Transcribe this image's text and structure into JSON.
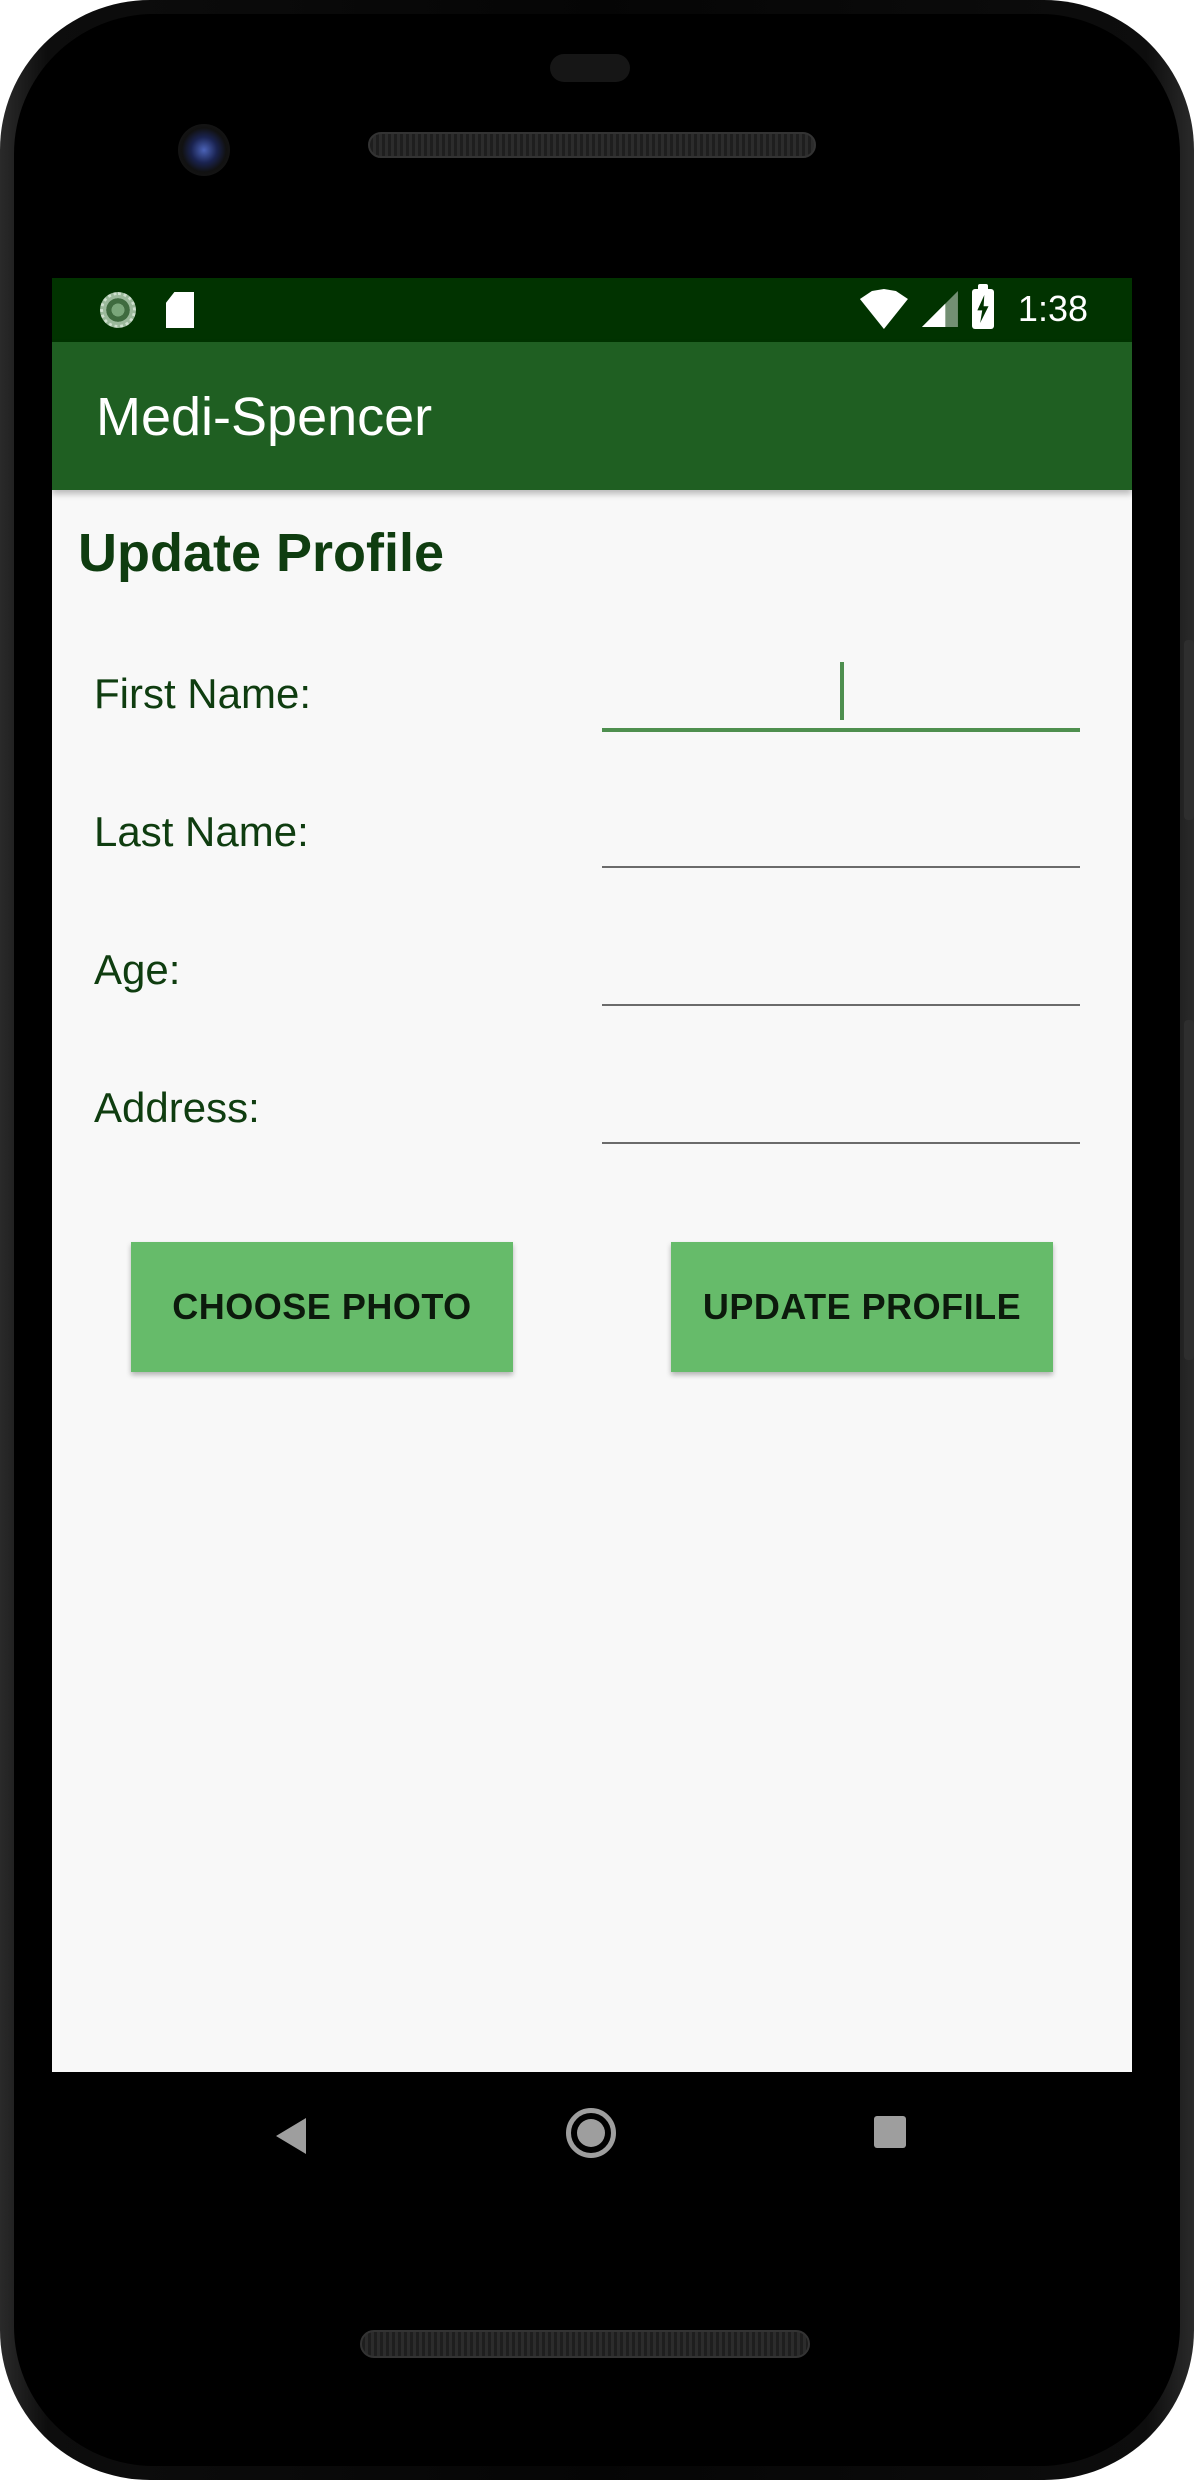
{
  "status_bar": {
    "time": "1:38",
    "icons": [
      "sync-icon",
      "sd-card-icon",
      "wifi-icon",
      "signal-icon",
      "battery-charging-icon"
    ]
  },
  "app_bar": {
    "title": "Medi-Spencer",
    "color": "#1f5f22",
    "status_color": "#013300"
  },
  "page": {
    "title": "Update Profile"
  },
  "form": {
    "fields": [
      {
        "label": "First Name:",
        "value": "",
        "focused": true
      },
      {
        "label": "Last Name:",
        "value": ""
      },
      {
        "label": "Age:",
        "value": ""
      },
      {
        "label": "Address:",
        "value": ""
      }
    ]
  },
  "buttons": {
    "choose_photo": "CHOOSE PHOTO",
    "update_profile": "UPDATE PROFILE",
    "color": "#66bb6a"
  },
  "nav_bar": {
    "icons": [
      "back-icon",
      "home-icon",
      "recents-icon"
    ]
  }
}
